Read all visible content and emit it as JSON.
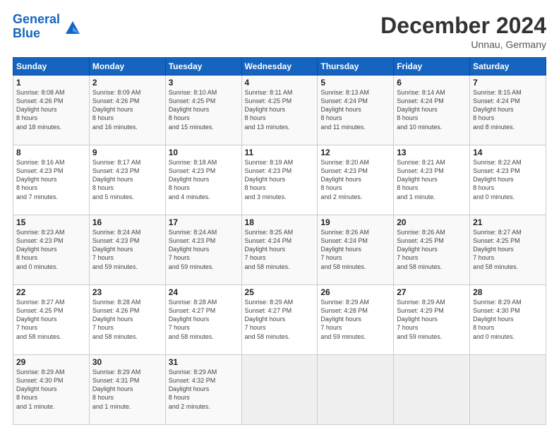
{
  "header": {
    "logo_line1": "General",
    "logo_line2": "Blue",
    "month_title": "December 2024",
    "subtitle": "Unnau, Germany"
  },
  "days_of_week": [
    "Sunday",
    "Monday",
    "Tuesday",
    "Wednesday",
    "Thursday",
    "Friday",
    "Saturday"
  ],
  "weeks": [
    [
      {
        "day": "1",
        "sunrise": "8:08 AM",
        "sunset": "4:26 PM",
        "daylight": "8 hours and 18 minutes."
      },
      {
        "day": "2",
        "sunrise": "8:09 AM",
        "sunset": "4:26 PM",
        "daylight": "8 hours and 16 minutes."
      },
      {
        "day": "3",
        "sunrise": "8:10 AM",
        "sunset": "4:25 PM",
        "daylight": "8 hours and 15 minutes."
      },
      {
        "day": "4",
        "sunrise": "8:11 AM",
        "sunset": "4:25 PM",
        "daylight": "8 hours and 13 minutes."
      },
      {
        "day": "5",
        "sunrise": "8:13 AM",
        "sunset": "4:24 PM",
        "daylight": "8 hours and 11 minutes."
      },
      {
        "day": "6",
        "sunrise": "8:14 AM",
        "sunset": "4:24 PM",
        "daylight": "8 hours and 10 minutes."
      },
      {
        "day": "7",
        "sunrise": "8:15 AM",
        "sunset": "4:24 PM",
        "daylight": "8 hours and 8 minutes."
      }
    ],
    [
      {
        "day": "8",
        "sunrise": "8:16 AM",
        "sunset": "4:23 PM",
        "daylight": "8 hours and 7 minutes."
      },
      {
        "day": "9",
        "sunrise": "8:17 AM",
        "sunset": "4:23 PM",
        "daylight": "8 hours and 5 minutes."
      },
      {
        "day": "10",
        "sunrise": "8:18 AM",
        "sunset": "4:23 PM",
        "daylight": "8 hours and 4 minutes."
      },
      {
        "day": "11",
        "sunrise": "8:19 AM",
        "sunset": "4:23 PM",
        "daylight": "8 hours and 3 minutes."
      },
      {
        "day": "12",
        "sunrise": "8:20 AM",
        "sunset": "4:23 PM",
        "daylight": "8 hours and 2 minutes."
      },
      {
        "day": "13",
        "sunrise": "8:21 AM",
        "sunset": "4:23 PM",
        "daylight": "8 hours and 1 minute."
      },
      {
        "day": "14",
        "sunrise": "8:22 AM",
        "sunset": "4:23 PM",
        "daylight": "8 hours and 0 minutes."
      }
    ],
    [
      {
        "day": "15",
        "sunrise": "8:23 AM",
        "sunset": "4:23 PM",
        "daylight": "8 hours and 0 minutes."
      },
      {
        "day": "16",
        "sunrise": "8:24 AM",
        "sunset": "4:23 PM",
        "daylight": "7 hours and 59 minutes."
      },
      {
        "day": "17",
        "sunrise": "8:24 AM",
        "sunset": "4:23 PM",
        "daylight": "7 hours and 59 minutes."
      },
      {
        "day": "18",
        "sunrise": "8:25 AM",
        "sunset": "4:24 PM",
        "daylight": "7 hours and 58 minutes."
      },
      {
        "day": "19",
        "sunrise": "8:26 AM",
        "sunset": "4:24 PM",
        "daylight": "7 hours and 58 minutes."
      },
      {
        "day": "20",
        "sunrise": "8:26 AM",
        "sunset": "4:25 PM",
        "daylight": "7 hours and 58 minutes."
      },
      {
        "day": "21",
        "sunrise": "8:27 AM",
        "sunset": "4:25 PM",
        "daylight": "7 hours and 58 minutes."
      }
    ],
    [
      {
        "day": "22",
        "sunrise": "8:27 AM",
        "sunset": "4:25 PM",
        "daylight": "7 hours and 58 minutes."
      },
      {
        "day": "23",
        "sunrise": "8:28 AM",
        "sunset": "4:26 PM",
        "daylight": "7 hours and 58 minutes."
      },
      {
        "day": "24",
        "sunrise": "8:28 AM",
        "sunset": "4:27 PM",
        "daylight": "7 hours and 58 minutes."
      },
      {
        "day": "25",
        "sunrise": "8:29 AM",
        "sunset": "4:27 PM",
        "daylight": "7 hours and 58 minutes."
      },
      {
        "day": "26",
        "sunrise": "8:29 AM",
        "sunset": "4:28 PM",
        "daylight": "7 hours and 59 minutes."
      },
      {
        "day": "27",
        "sunrise": "8:29 AM",
        "sunset": "4:29 PM",
        "daylight": "7 hours and 59 minutes."
      },
      {
        "day": "28",
        "sunrise": "8:29 AM",
        "sunset": "4:30 PM",
        "daylight": "8 hours and 0 minutes."
      }
    ],
    [
      {
        "day": "29",
        "sunrise": "8:29 AM",
        "sunset": "4:30 PM",
        "daylight": "8 hours and 1 minute."
      },
      {
        "day": "30",
        "sunrise": "8:29 AM",
        "sunset": "4:31 PM",
        "daylight": "8 hours and 1 minute."
      },
      {
        "day": "31",
        "sunrise": "8:29 AM",
        "sunset": "4:32 PM",
        "daylight": "8 hours and 2 minutes."
      },
      null,
      null,
      null,
      null
    ]
  ]
}
